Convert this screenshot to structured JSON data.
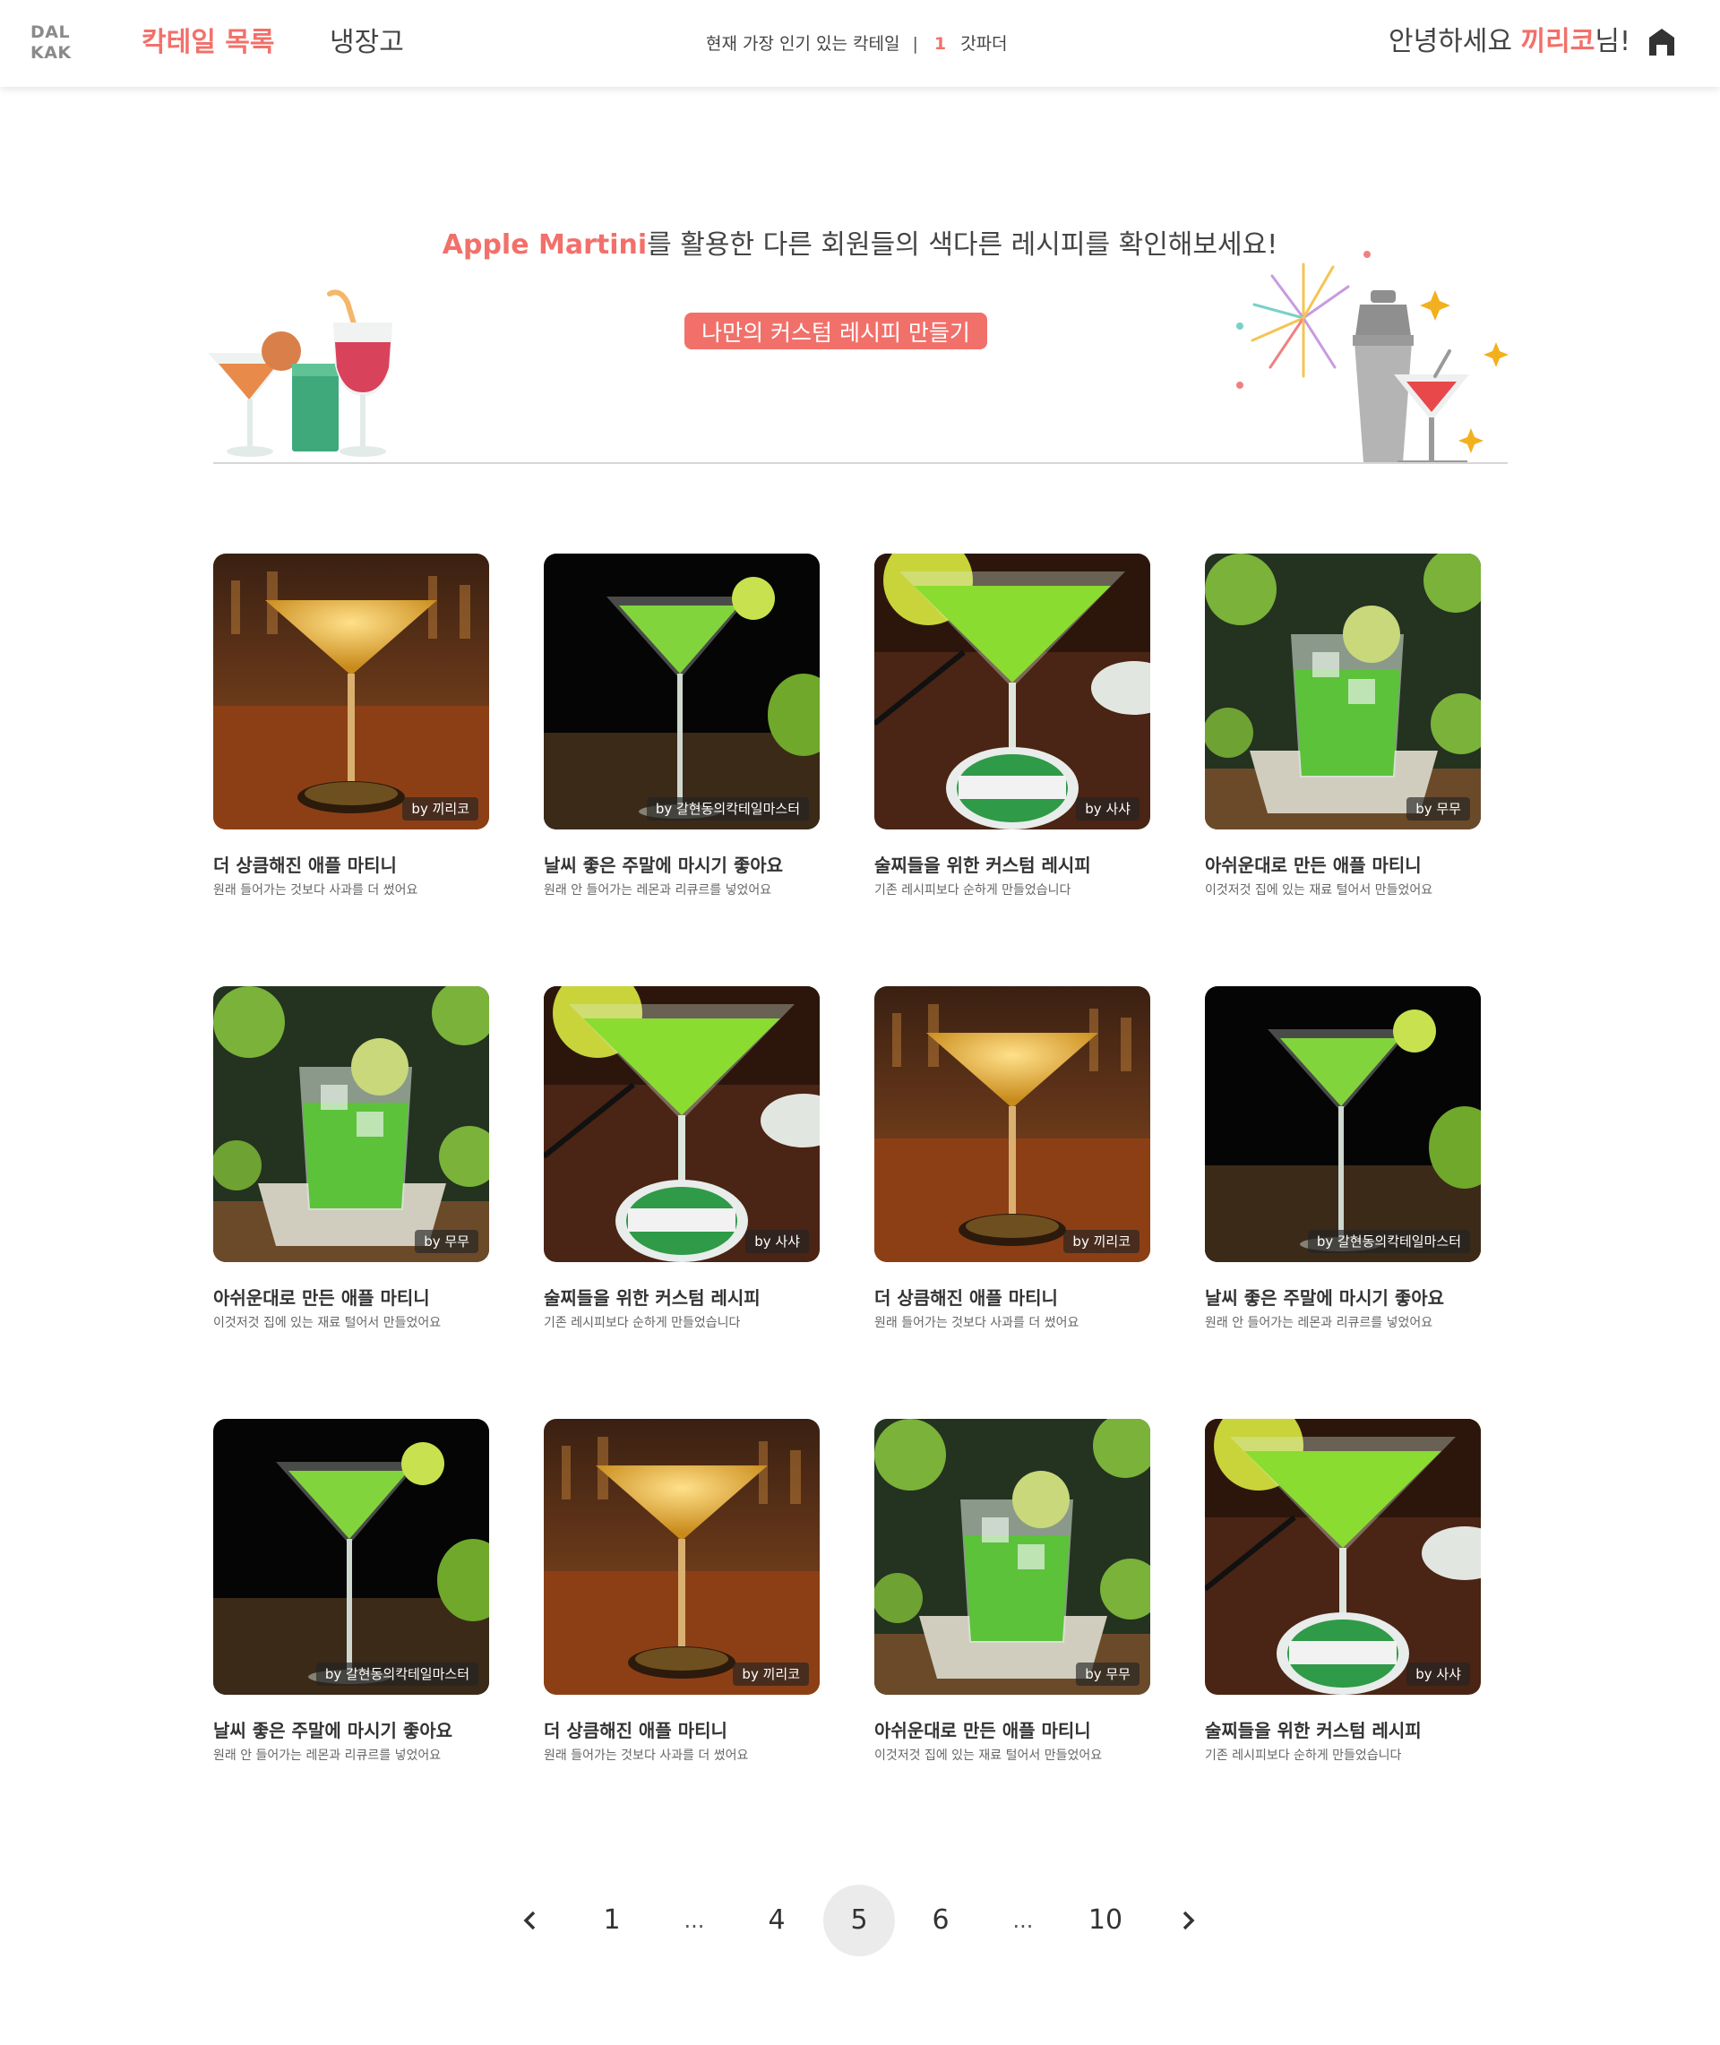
{
  "nav": {
    "logo_line1": "DAL",
    "logo_line2": "KAK",
    "link_list": "칵테일 목록",
    "link_fridge": "냉장고",
    "ticker_label": "현재 가장 인기 있는 칵테일",
    "ticker_sep": "|",
    "ticker_rank": "1",
    "ticker_name": "갓파더",
    "greet_prefix": "안녕하세요 ",
    "greet_user": "끼리코",
    "greet_suffix": "님!",
    "home_icon": "home-icon"
  },
  "hero": {
    "cocktail_name": "Apple Martini",
    "title_rest": "를 활용한 다른 회원들의 색다른 레시피를 확인해보세요!",
    "button_label": "나만의 커스텀 레시피 만들기"
  },
  "colors": {
    "accent": "#f2706a",
    "grey_text": "#444444"
  },
  "cards": [
    {
      "img": "amber",
      "by": "by 끼리코",
      "title": "더 상큼해진 애플 마티니",
      "desc": "원래 들어가는 것보다 사과를 더 썼어요"
    },
    {
      "img": "dark",
      "by": "by 갈현동의칵테일마스터",
      "title": "날씨 좋은 주말에 마시기 좋아요",
      "desc": "원래 안 들어가는 레몬과 리큐르를 넣었어요"
    },
    {
      "img": "heineken",
      "by": "by 사샤",
      "title": "술찌들을 위한 커스텀 레시피",
      "desc": "기존 레시피보다 순하게 만들었습니다"
    },
    {
      "img": "rocks",
      "by": "by 무무",
      "title": "아쉬운대로 만든 애플 마티니",
      "desc": "이것저것 집에 있는 재료 털어서 만들었어요"
    },
    {
      "img": "rocks",
      "by": "by 무무",
      "title": "아쉬운대로 만든 애플 마티니",
      "desc": "이것저것 집에 있는 재료 털어서 만들었어요"
    },
    {
      "img": "heineken",
      "by": "by 사샤",
      "title": "술찌들을 위한 커스텀 레시피",
      "desc": "기존 레시피보다 순하게 만들었습니다"
    },
    {
      "img": "amber",
      "by": "by 끼리코",
      "title": "더 상큼해진 애플 마티니",
      "desc": "원래 들어가는 것보다 사과를 더 썼어요"
    },
    {
      "img": "dark",
      "by": "by 갈현동의칵테일마스터",
      "title": "날씨 좋은 주말에 마시기 좋아요",
      "desc": "원래 안 들어가는 레몬과 리큐르를 넣었어요"
    },
    {
      "img": "dark",
      "by": "by 갈현동의칵테일마스터",
      "title": "날씨 좋은 주말에 마시기 좋아요",
      "desc": "원래 안 들어가는 레몬과 리큐르를 넣었어요"
    },
    {
      "img": "amber",
      "by": "by 끼리코",
      "title": "더 상큼해진 애플 마티니",
      "desc": "원래 들어가는 것보다 사과를 더 썼어요"
    },
    {
      "img": "rocks",
      "by": "by 무무",
      "title": "아쉬운대로 만든 애플 마티니",
      "desc": "이것저것 집에 있는 재료 털어서 만들었어요"
    },
    {
      "img": "heineken",
      "by": "by 사샤",
      "title": "술찌들을 위한 커스텀 레시피",
      "desc": "기존 레시피보다 순하게 만들었습니다"
    }
  ],
  "pagination": {
    "prev_icon": "chevron-left-icon",
    "next_icon": "chevron-right-icon",
    "items": [
      "1",
      "...",
      "4",
      "5",
      "6",
      "...",
      "10"
    ],
    "current": "5"
  }
}
